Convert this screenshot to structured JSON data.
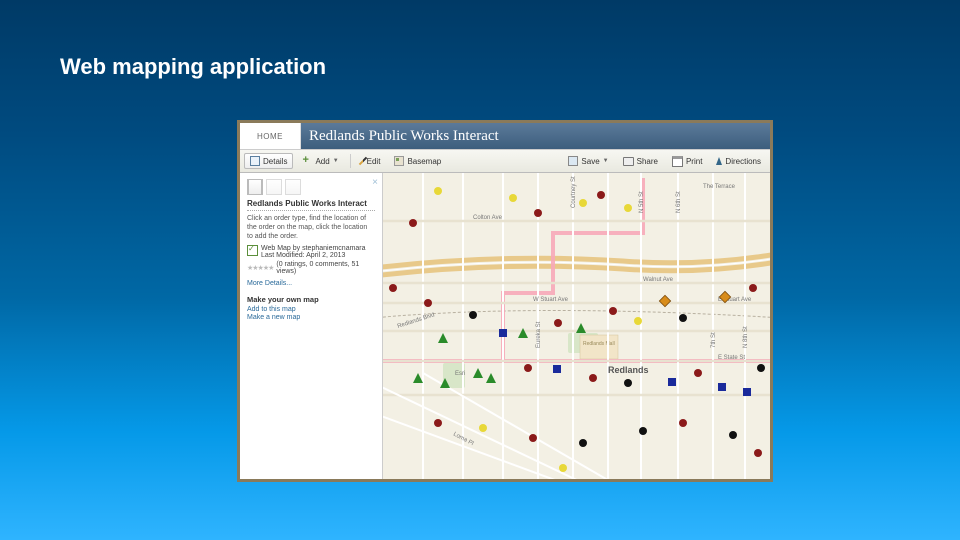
{
  "slide": {
    "title": "Web mapping application"
  },
  "titlebar": {
    "home": "HOME",
    "title": "Redlands Public Works Interact"
  },
  "toolbar": {
    "details": "Details",
    "add": "Add",
    "edit": "Edit",
    "basemap": "Basemap",
    "save": "Save",
    "share": "Share",
    "print": "Print",
    "directions": "Directions"
  },
  "sidebar": {
    "title": "Redlands Public Works Interact",
    "desc": "Click an order type, find the location of the order on the map, click the location to add the order.",
    "author_line": "Web Map by stephaniemcnamara",
    "modified": "Last Modified: April 2, 2013",
    "ratings": "(0 ratings, 0 comments, 51 views)",
    "more": "More Details...",
    "sub": "Make your own map",
    "link1": "Add to this map",
    "link2": "Make a new map"
  },
  "map": {
    "city": "Redlands",
    "mall": "Redlands Mall",
    "esri": "Esri",
    "streets": {
      "colton": "Colton Ave",
      "walnut": "Walnut Ave",
      "stuart": "W Stuart Ave",
      "estuart": "E Stuart Ave",
      "state": "E State St",
      "terrace": "The Terrace",
      "redblvd": "Redlands Blvd",
      "lomaprt": "Loma Pl",
      "courtney": "Courtney St",
      "n5": "N 5th St",
      "n6": "N 6th St",
      "n7": "7th St",
      "n8": "N 8th St",
      "eureka": "Eureka St"
    }
  }
}
